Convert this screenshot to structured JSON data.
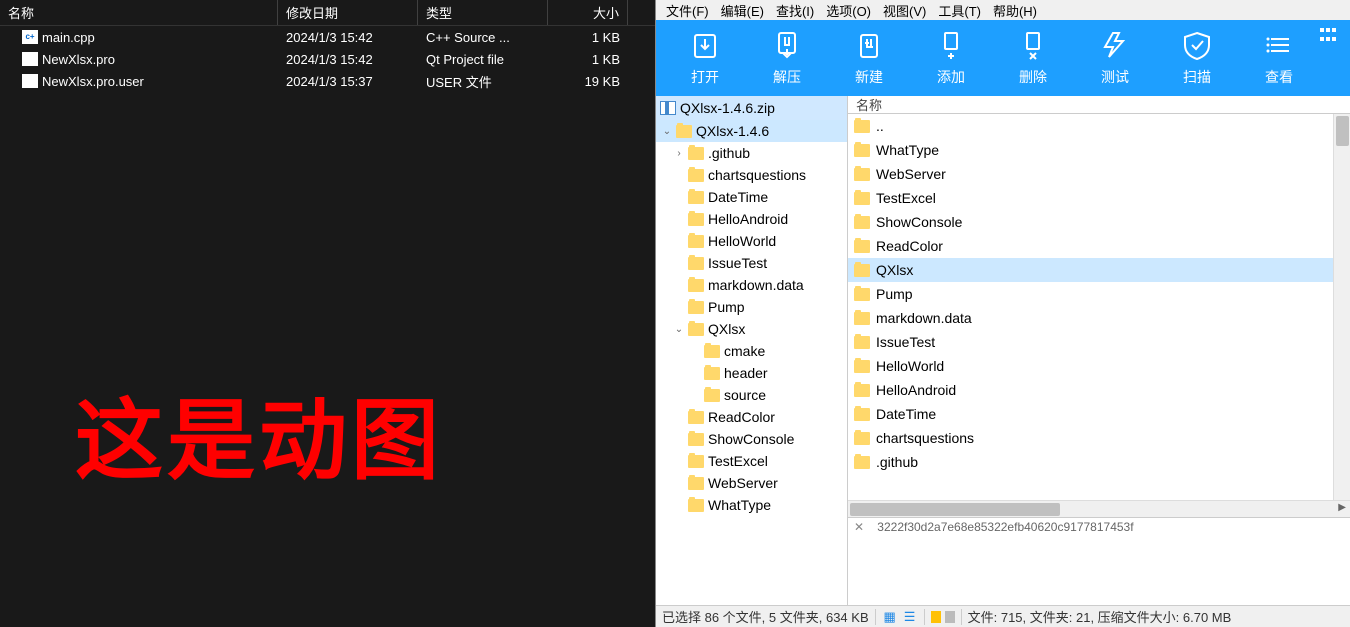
{
  "left": {
    "headers": {
      "name": "名称",
      "date": "修改日期",
      "type": "类型",
      "size": "大小"
    },
    "files": [
      {
        "icon": "c+",
        "name": "main.cpp",
        "date": "2024/1/3 15:42",
        "type": "C++ Source ...",
        "size": "1 KB"
      },
      {
        "icon": "qt",
        "name": "NewXlsx.pro",
        "date": "2024/1/3 15:42",
        "type": "Qt Project file",
        "size": "1 KB"
      },
      {
        "icon": "u",
        "name": "NewXlsx.pro.user",
        "date": "2024/1/3 15:37",
        "type": "USER 文件",
        "size": "19 KB"
      }
    ],
    "overlay_text": "这是动图"
  },
  "menu": {
    "file": "文件(F)",
    "edit": "编辑(E)",
    "find": "查找(I)",
    "options": "选项(O)",
    "view": "视图(V)",
    "tools": "工具(T)",
    "help": "帮助(H)"
  },
  "toolbar": {
    "open": "打开",
    "extract": "解压",
    "new": "新建",
    "add": "添加",
    "delete": "删除",
    "test": "测试",
    "scan": "扫描",
    "view": "查看"
  },
  "tree": {
    "zip_name": "QXlsx-1.4.6.zip",
    "root": "QXlsx-1.4.6",
    "level1": [
      ".github",
      "chartsquestions",
      "DateTime",
      "HelloAndroid",
      "HelloWorld",
      "IssueTest",
      "markdown.data",
      "Pump",
      "QXlsx",
      "ReadColor",
      "ShowConsole",
      "TestExcel",
      "WebServer",
      "WhatType"
    ],
    "qxlsx_children": [
      "cmake",
      "header",
      "source"
    ]
  },
  "list": {
    "header_name": "名称",
    "items": [
      "..",
      "WhatType",
      "WebServer",
      "TestExcel",
      "ShowConsole",
      "ReadColor",
      "QXlsx",
      "Pump",
      "markdown.data",
      "IssueTest",
      "HelloWorld",
      "HelloAndroid",
      "DateTime",
      "chartsquestions",
      ".github"
    ],
    "selected": "QXlsx"
  },
  "log": {
    "hash": "3222f30d2a7e68e85322efb40620c9177817453f"
  },
  "status": {
    "selection": "已选择 86 个文件, 5 文件夹, 634 KB",
    "totals": "文件: 715, 文件夹: 21, 压缩文件大小: 6.70 MB"
  }
}
